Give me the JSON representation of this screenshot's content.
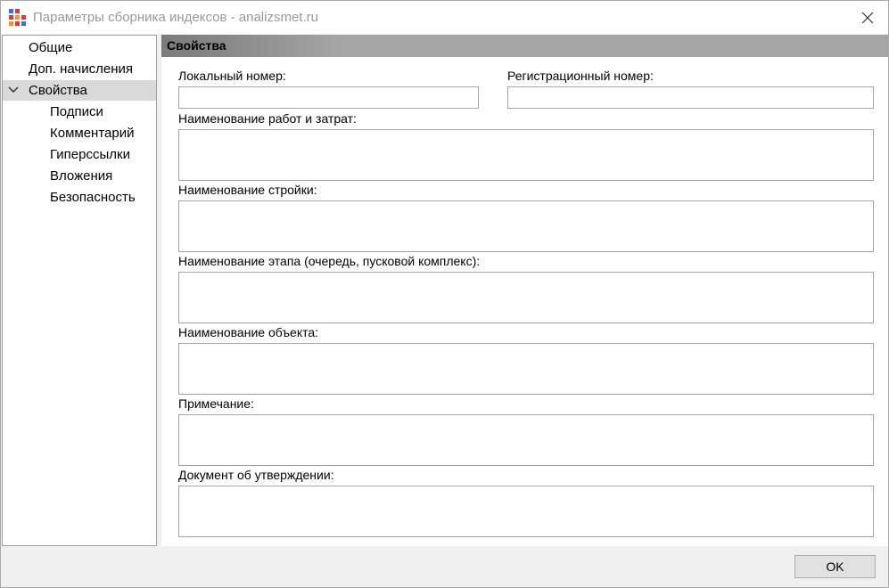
{
  "window": {
    "title": "Параметры сборника индексов - analizsmet.ru",
    "app_icon": "grid-blocks-icon",
    "close_icon": "close-icon"
  },
  "tree": {
    "items": [
      {
        "label": "Общие",
        "level": 0,
        "selected": false
      },
      {
        "label": "Доп. начисления",
        "level": 0,
        "selected": false
      },
      {
        "label": "Свойства",
        "level": 0,
        "selected": true,
        "expanded": true
      },
      {
        "label": "Подписи",
        "level": 1,
        "selected": false
      },
      {
        "label": "Комментарий",
        "level": 1,
        "selected": false
      },
      {
        "label": "Гиперссылки",
        "level": 1,
        "selected": false
      },
      {
        "label": "Вложения",
        "level": 1,
        "selected": false
      },
      {
        "label": "Безопасность",
        "level": 1,
        "selected": false
      }
    ]
  },
  "content": {
    "section_title": "Свойства",
    "fields": {
      "local_number": {
        "label": "Локальный номер:",
        "value": ""
      },
      "registration_number": {
        "label": "Регистрационный номер:",
        "value": ""
      },
      "work_name": {
        "label": "Наименование работ и затрат:",
        "value": ""
      },
      "construction_name": {
        "label": "Наименование стройки:",
        "value": ""
      },
      "stage_name": {
        "label": "Наименование этапа (очередь, пусковой комплекс):",
        "value": ""
      },
      "object_name": {
        "label": "Наименование объекта:",
        "value": ""
      },
      "note": {
        "label": "Примечание:",
        "value": ""
      },
      "approval_document": {
        "label": "Документ об утверждении:",
        "value": ""
      }
    }
  },
  "footer": {
    "ok_label": "OK"
  },
  "colors": {
    "header_gradient_start": "#7b7b7b",
    "header_gradient_end": "#a5a5a5",
    "selected_item_bg": "#d9d9d9",
    "window_bg": "#f0f0f0"
  }
}
